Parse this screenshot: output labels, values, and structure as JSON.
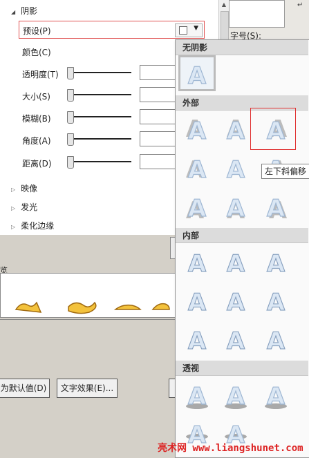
{
  "panel": {
    "section_title": "阴影",
    "preset_label": "预设(P)",
    "color_label": "颜色(C)",
    "properties": [
      {
        "key": "transparency",
        "label": "透明度(T)"
      },
      {
        "key": "size",
        "label": "大小(S)"
      },
      {
        "key": "blur",
        "label": "模糊(B)"
      },
      {
        "key": "angle",
        "label": "角度(A)"
      },
      {
        "key": "distance",
        "label": "距离(D)"
      }
    ],
    "collapsed_sections": [
      "映像",
      "发光",
      "柔化边缘"
    ]
  },
  "right": {
    "font_size_label": "字号(S):",
    "return_glyph": "↵"
  },
  "preview": {
    "label": "览"
  },
  "buttons": {
    "set_default": "为默认值(D)",
    "text_effects": "文字效果(E)..."
  },
  "menu": {
    "groups": [
      {
        "name": "无阴影",
        "items": 1
      },
      {
        "name": "外部",
        "items": 9
      },
      {
        "name": "内部",
        "items": 9
      },
      {
        "name": "透视",
        "items": 5
      }
    ],
    "tile_glyph": "A",
    "selected": "外部 左下斜偏移"
  },
  "tooltip": "左下斜偏移",
  "watermark": "亮术网 www.liangshunet.com",
  "colors": {
    "accent_red": "#e03030",
    "glyph_fill": "#dbe7f4",
    "glyph_stroke": "#9fb7d3"
  }
}
